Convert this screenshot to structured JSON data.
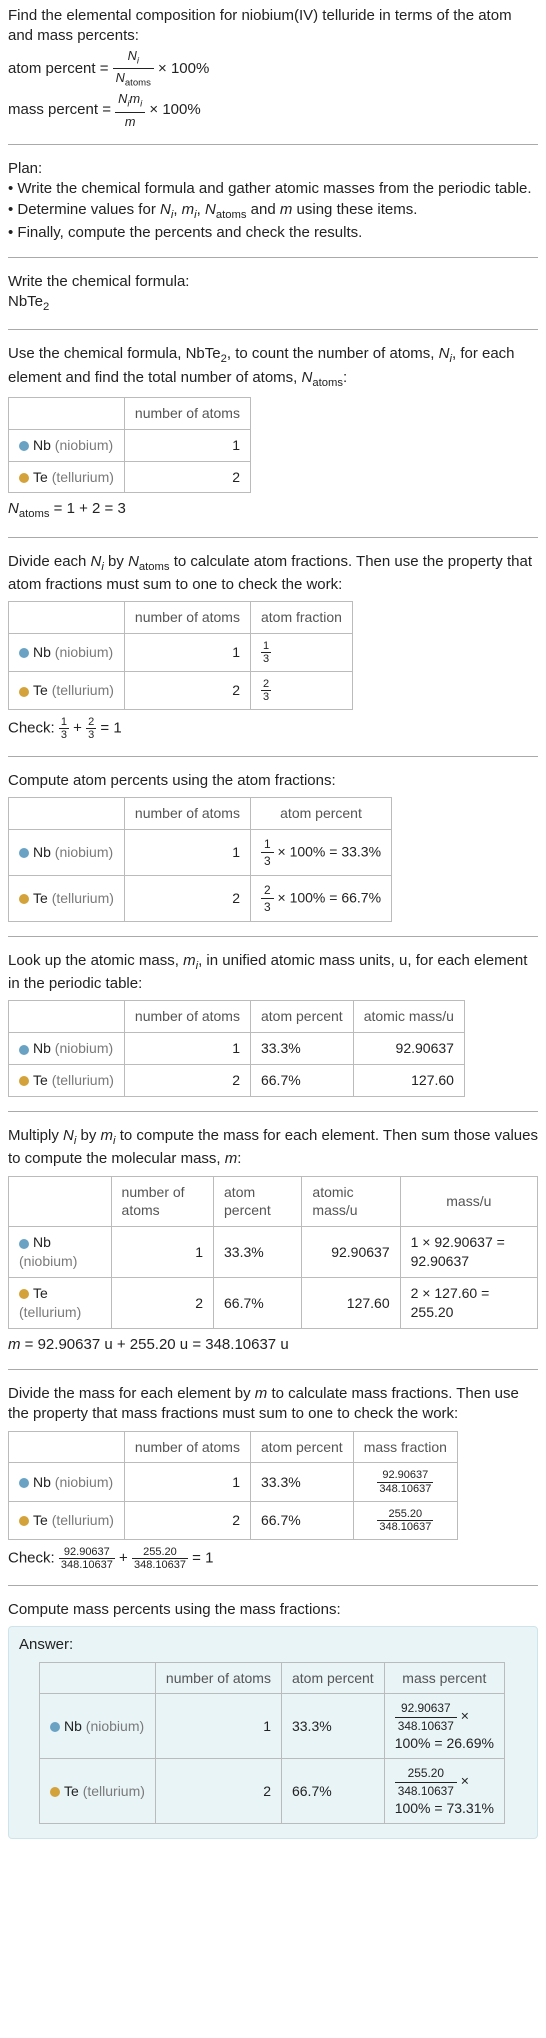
{
  "intro": "Find the elemental composition for niobium(IV) telluride in terms of the atom and mass percents:",
  "formulas": {
    "atom_label": "atom percent",
    "mass_label": "mass percent",
    "n_i": "N",
    "n_i_sub": "i",
    "n_atoms": "N",
    "n_atoms_sub": "atoms",
    "times100": " × 100%",
    "mass_num_a": "N",
    "mass_num_b": "m",
    "m": "m"
  },
  "plan": {
    "title": "Plan:",
    "l1": "• Write the chemical formula and gather atomic masses from the periodic table.",
    "l2a": "• Determine values for ",
    "l2b": " using these items.",
    "terms": {
      "Ni": "N",
      "i": "i",
      "mi": "m",
      "Natoms": "N",
      "atoms": "atoms",
      "m": "m",
      "and": " and "
    },
    "l3": "• Finally, compute the percents and check the results."
  },
  "step_formula": {
    "title": "Write the chemical formula:",
    "value": "NbTe",
    "sub": "2"
  },
  "step_count": {
    "text_a": "Use the chemical formula, NbTe",
    "sub": "2",
    "text_b": ", to count the number of atoms, ",
    "Ni": "N",
    "i": "i",
    "text_c": ", for each element and find the total number of atoms, ",
    "Natoms": "N",
    "atoms": "atoms",
    "text_d": ":",
    "sum": " = 1 + 2 = 3"
  },
  "elements": {
    "nb_symbol": "Nb",
    "nb_name": "(niobium)",
    "te_symbol": "Te",
    "te_name": "(tellurium)"
  },
  "headers": {
    "num_atoms": "number of atoms",
    "atom_frac": "atom fraction",
    "atom_pct": "atom percent",
    "atomic_mass": "atomic mass/u",
    "mass_u": "mass/u",
    "mass_frac": "mass fraction",
    "mass_pct": "mass percent"
  },
  "values": {
    "nb_atoms": "1",
    "te_atoms": "2",
    "frac_1_3_n": "1",
    "frac_1_3_d": "3",
    "frac_2_3_n": "2",
    "frac_2_3_d": "3",
    "nb_pct_line": " × 100% = 33.3%",
    "te_pct_line": " × 100% = 66.7%",
    "nb_pct": "33.3%",
    "te_pct": "66.7%",
    "nb_mass": "92.90637",
    "te_mass": "127.60",
    "nb_massu": "1 × 92.90637 = 92.90637",
    "te_massu": "2 × 127.60 = 255.20",
    "m_sum": " = 92.90637 u + 255.20 u = 348.10637 u",
    "mf_nb_n": "92.90637",
    "mf_nb_d": "348.10637",
    "mf_te_n": "255.20",
    "mf_te_d": "348.10637",
    "check_sum": " = 1",
    "mp_nb_a": "92.90637",
    "mp_nb_b": "348.10637",
    "mp_nb_c": "100% = 26.69%",
    "mp_te_a": "255.20",
    "mp_te_b": "348.10637",
    "mp_te_c": "100% = 73.31%"
  },
  "texts": {
    "div_frac": "Divide each ",
    "by": " by ",
    "div_frac2": " to calculate atom fractions. Then use the property that atom fractions must sum to one to check the work:",
    "check": "Check: ",
    "plus": " + ",
    "eq1": " = 1",
    "compute_atom_pct": "Compute atom percents using the atom fractions:",
    "lookup": "Look up the atomic mass, ",
    "mi": "m",
    "i": "i",
    "lookup2": ", in unified atomic mass units, u, for each element in the periodic table:",
    "multiply": "Multiply ",
    "multiply2": " to compute the mass for each element. Then sum those values to compute the molecular mass, ",
    "m": "m",
    "colon": ":",
    "div_mass": "Divide the mass for each element by ",
    "div_mass2": " to calculate mass fractions. Then use the property that mass fractions must sum to one to check the work:",
    "compute_mass_pct": "Compute mass percents using the mass fractions:",
    "answer": "Answer:",
    "times": " × "
  }
}
